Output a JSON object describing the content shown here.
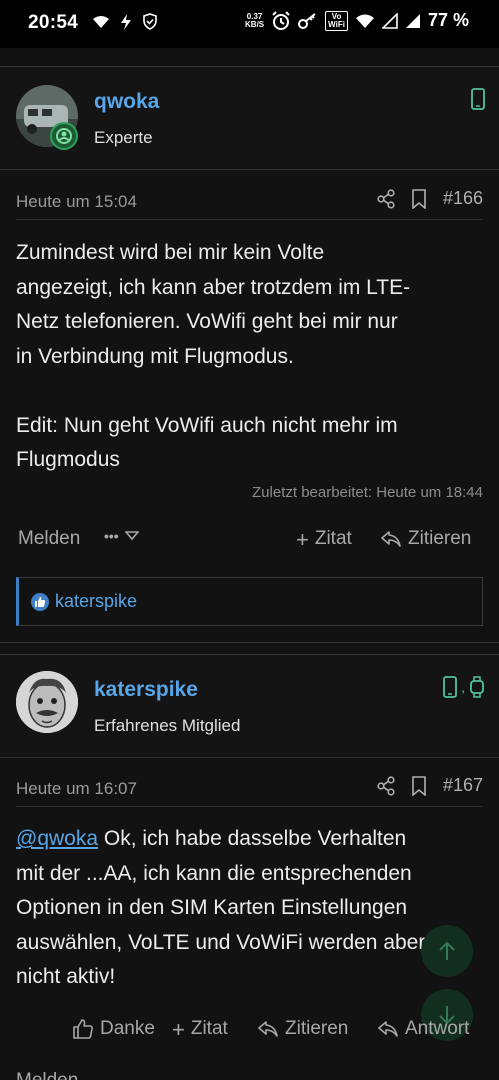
{
  "status_bar": {
    "time": "20:54",
    "speed_value": "0.37",
    "speed_unit": "KB/S",
    "volte_top": "Vo",
    "volte_bottom": "WiFi",
    "battery": "77 %"
  },
  "posts": [
    {
      "username": "qwoka",
      "user_title": "Experte",
      "date": "Heute um 15:04",
      "post_number": "#166",
      "body_lines": [
        "Zumindest wird bei mir kein Volte",
        "angezeigt, ich kann aber trotzdem im LTE-",
        "Netz telefonieren. VoWifi geht bei mir nur",
        "in Verbindung mit Flugmodus.",
        "",
        "Edit: Nun geht VoWifi auch nicht mehr im",
        "Flugmodus"
      ],
      "edited_note": "Zuletzt bearbeitet: Heute um 18:44",
      "actions": {
        "report": "Melden",
        "more": "•••",
        "quote_add": "Zitat",
        "quote": "Zitieren"
      },
      "likes": {
        "user": "katerspike"
      }
    },
    {
      "username": "katerspike",
      "user_title": "Erfahrenes Mitglied",
      "date": "Heute um 16:07",
      "post_number": "#167",
      "mention": "@qwoka",
      "body_lines": [
        " Ok, ich habe dasselbe Verhalten",
        "mit der ...AA, ich kann die entsprechenden",
        "Optionen in den SIM Karten Einstellungen",
        "auswählen, VoLTE und VoWiFi werden aber",
        "nicht aktiv!"
      ],
      "actions": {
        "thanks": "Danke",
        "quote_add": "Zitat",
        "quote": "Zitieren",
        "reply": "Antwort",
        "report": "Melden"
      }
    }
  ],
  "colors": {
    "accent": "#58a6e8",
    "background": "#121212",
    "like_blue": "#3d80c7",
    "device_icon": "#4fc3a1"
  }
}
